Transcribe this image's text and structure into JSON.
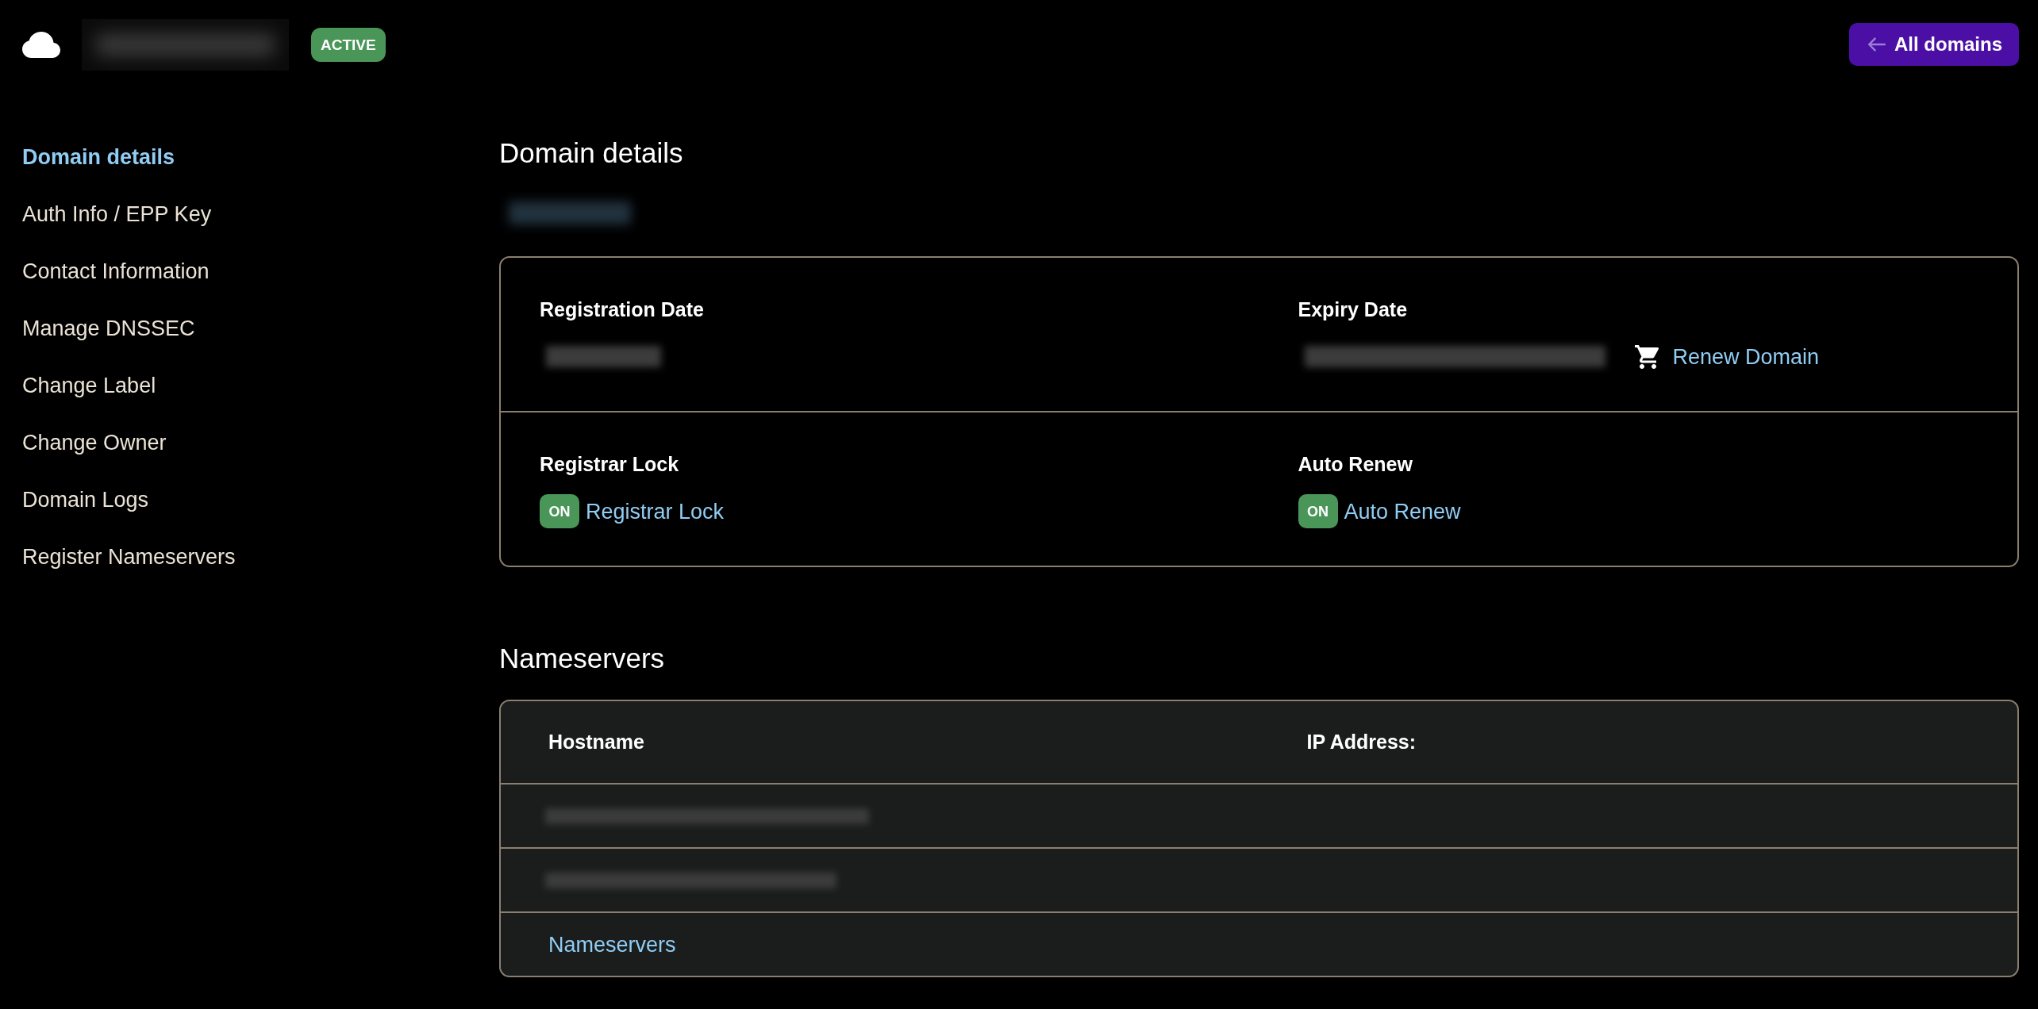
{
  "header": {
    "domain_name": {
      "redacted": true
    },
    "status_badge": "ACTIVE",
    "back_button": "All domains"
  },
  "sidebar": {
    "items": [
      {
        "label": "Domain details",
        "selected": true
      },
      {
        "label": "Auth Info / EPP Key",
        "selected": false
      },
      {
        "label": "Contact Information",
        "selected": false
      },
      {
        "label": "Manage DNSSEC",
        "selected": false
      },
      {
        "label": "Change Label",
        "selected": false
      },
      {
        "label": "Change Owner",
        "selected": false
      },
      {
        "label": "Domain Logs",
        "selected": false
      },
      {
        "label": "Register Nameservers",
        "selected": false
      }
    ]
  },
  "domain_details": {
    "title": "Domain details",
    "domain": {
      "redacted": true
    },
    "fields": [
      {
        "kind": "date",
        "label": "Registration Date",
        "value": {
          "redacted": true
        }
      },
      {
        "kind": "date",
        "label": "Expiry Date",
        "value": {
          "redacted": true
        },
        "action": "Renew Domain"
      },
      {
        "kind": "toggle",
        "label": "Registrar Lock",
        "on": true,
        "badge": "ON",
        "link": "Registrar Lock"
      },
      {
        "kind": "toggle",
        "label": "Auto Renew",
        "on": true,
        "badge": "ON",
        "link": "Auto Renew"
      }
    ]
  },
  "nameservers": {
    "title": "Nameservers",
    "columns": [
      "Hostname",
      "IP Address:"
    ],
    "rows": [
      {
        "hostname": {
          "redacted": true
        }
      },
      {
        "hostname": {
          "redacted": true
        }
      }
    ],
    "footer_link": "Nameservers"
  }
}
